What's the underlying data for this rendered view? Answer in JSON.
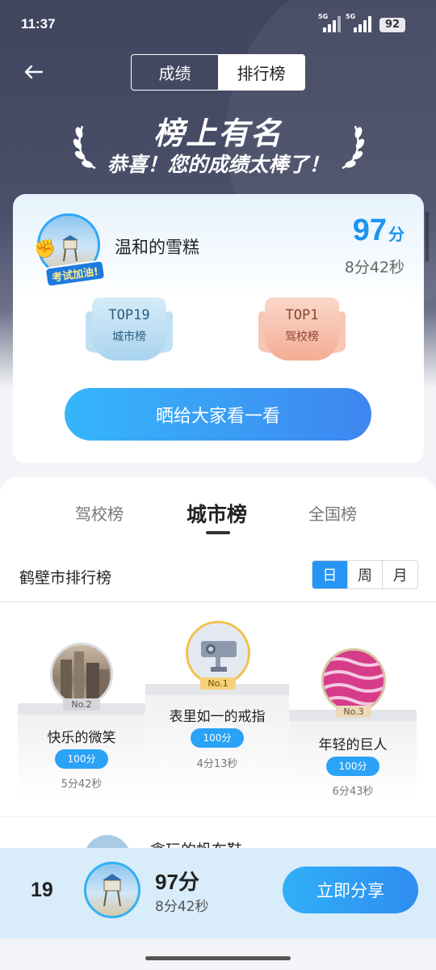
{
  "status_bar": {
    "time": "11:37",
    "sig1": "5G",
    "sig2": "5G",
    "battery": "92"
  },
  "header": {
    "tabs": [
      "成绩",
      "排行榜"
    ],
    "active_tab": "排行榜"
  },
  "hero": {
    "title": "榜上有名",
    "subtitle": "恭喜！您的成绩太棒了！"
  },
  "card": {
    "user_name": "温和的雪糕",
    "avatar_badge": "考试加油!",
    "score": "97",
    "score_unit": "分",
    "time": "8分42秒",
    "badges": [
      {
        "top": "TOP19",
        "label": "城市榜"
      },
      {
        "top": "TOP1",
        "label": "驾校榜"
      }
    ],
    "share_label": "晒给大家看一看"
  },
  "board": {
    "tabs": [
      "驾校榜",
      "城市榜",
      "全国榜"
    ],
    "active_tab": "城市榜",
    "title": "鹤壁市排行榜",
    "periods": [
      "日",
      "周",
      "月"
    ],
    "active_period": "日",
    "podium": [
      {
        "rank": "No.2",
        "name": "快乐的微笑",
        "score": "100分",
        "time": "5分42秒"
      },
      {
        "rank": "No.1",
        "name": "表里如一的戒指",
        "score": "100分",
        "time": "4分13秒"
      },
      {
        "rank": "No.3",
        "name": "年轻的巨人",
        "score": "100分",
        "time": "6分43秒"
      }
    ],
    "next_row_name": "贪玩的帆布鞋"
  },
  "bottom_bar": {
    "rank": "19",
    "score": "97分",
    "time": "8分42秒",
    "share_label": "立即分享"
  },
  "colors": {
    "accent": "#1b95f2",
    "hero_bg": "#40455e",
    "city_badge": "#aad3ee",
    "school_badge": "#f3ad95",
    "rank1_ring": "#f1c14e"
  }
}
